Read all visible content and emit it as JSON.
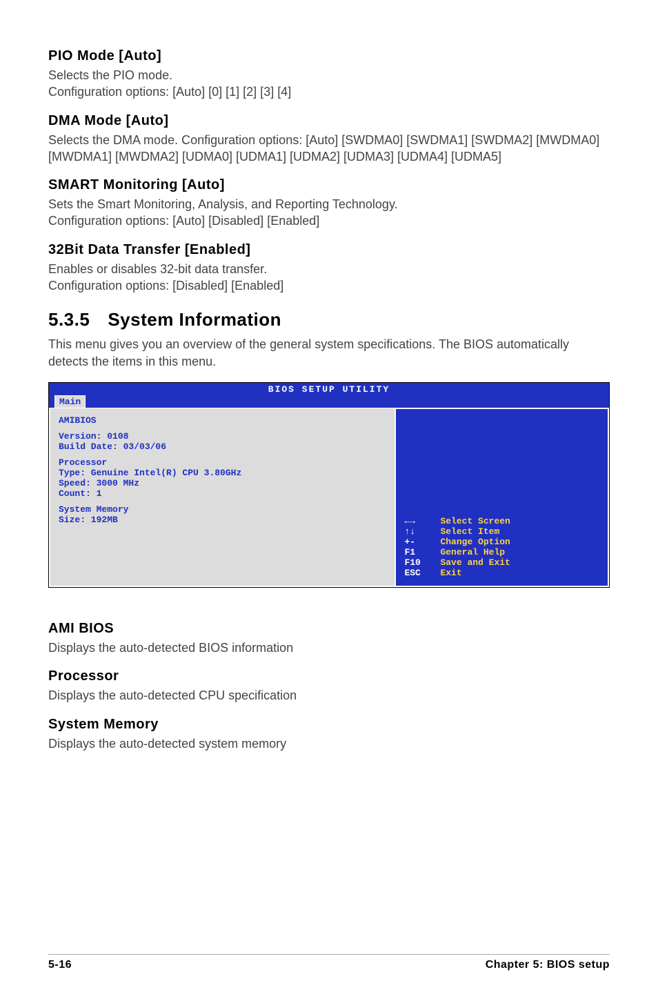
{
  "sections": {
    "pio": {
      "heading": "PIO Mode [Auto]",
      "line1": "Selects the PIO mode.",
      "line2": "Configuration options: [Auto] [0] [1] [2] [3] [4]"
    },
    "dma": {
      "heading": "DMA Mode [Auto]",
      "text": "Selects the DMA mode. Configuration options: [Auto] [SWDMA0] [SWDMA1] [SWDMA2] [MWDMA0] [MWDMA1] [MWDMA2] [UDMA0] [UDMA1] [UDMA2] [UDMA3] [UDMA4] [UDMA5]"
    },
    "smart": {
      "heading": "SMART Monitoring [Auto]",
      "line1": "Sets the Smart Monitoring, Analysis, and Reporting Technology.",
      "line2": "Configuration options: [Auto] [Disabled] [Enabled]"
    },
    "transfer": {
      "heading": "32Bit Data Transfer [Enabled]",
      "line1": "Enables or disables 32-bit data transfer.",
      "line2": "Configuration options: [Disabled] [Enabled]"
    },
    "sysinfo": {
      "number": "5.3.5",
      "title": "System Information",
      "text": "This menu gives you an overview of the general system specifications. The BIOS automatically detects the items in this menu."
    },
    "amibios": {
      "heading": "AMI BIOS",
      "text": "Displays the auto-detected BIOS information"
    },
    "processor": {
      "heading": "Processor",
      "text": "Displays the auto-detected CPU specification"
    },
    "sysmem": {
      "heading": "System Memory",
      "text": "Displays the auto-detected system memory"
    }
  },
  "bios": {
    "title": "BIOS SETUP UTILITY",
    "tab": "Main",
    "left": {
      "block1": "AMIBIOS",
      "block2": "Version: 0108\nBuild Date: 03/03/06",
      "block3": "Processor\nType: Genuine Intel(R) CPU 3.80GHz\nSpeed: 3000 MHz\nCount: 1",
      "block4": "System Memory\nSize: 192MB"
    },
    "help": [
      {
        "key": "←→",
        "txt": "Select Screen"
      },
      {
        "key": "↑↓",
        "txt": "Select Item"
      },
      {
        "key": "+-",
        "txt": "Change Option"
      },
      {
        "key": "F1",
        "txt": "General Help"
      },
      {
        "key": "F10",
        "txt": "Save and Exit"
      },
      {
        "key": "ESC",
        "txt": "Exit"
      }
    ]
  },
  "footer": {
    "left": "5-16",
    "right": "Chapter 5: BIOS setup"
  }
}
